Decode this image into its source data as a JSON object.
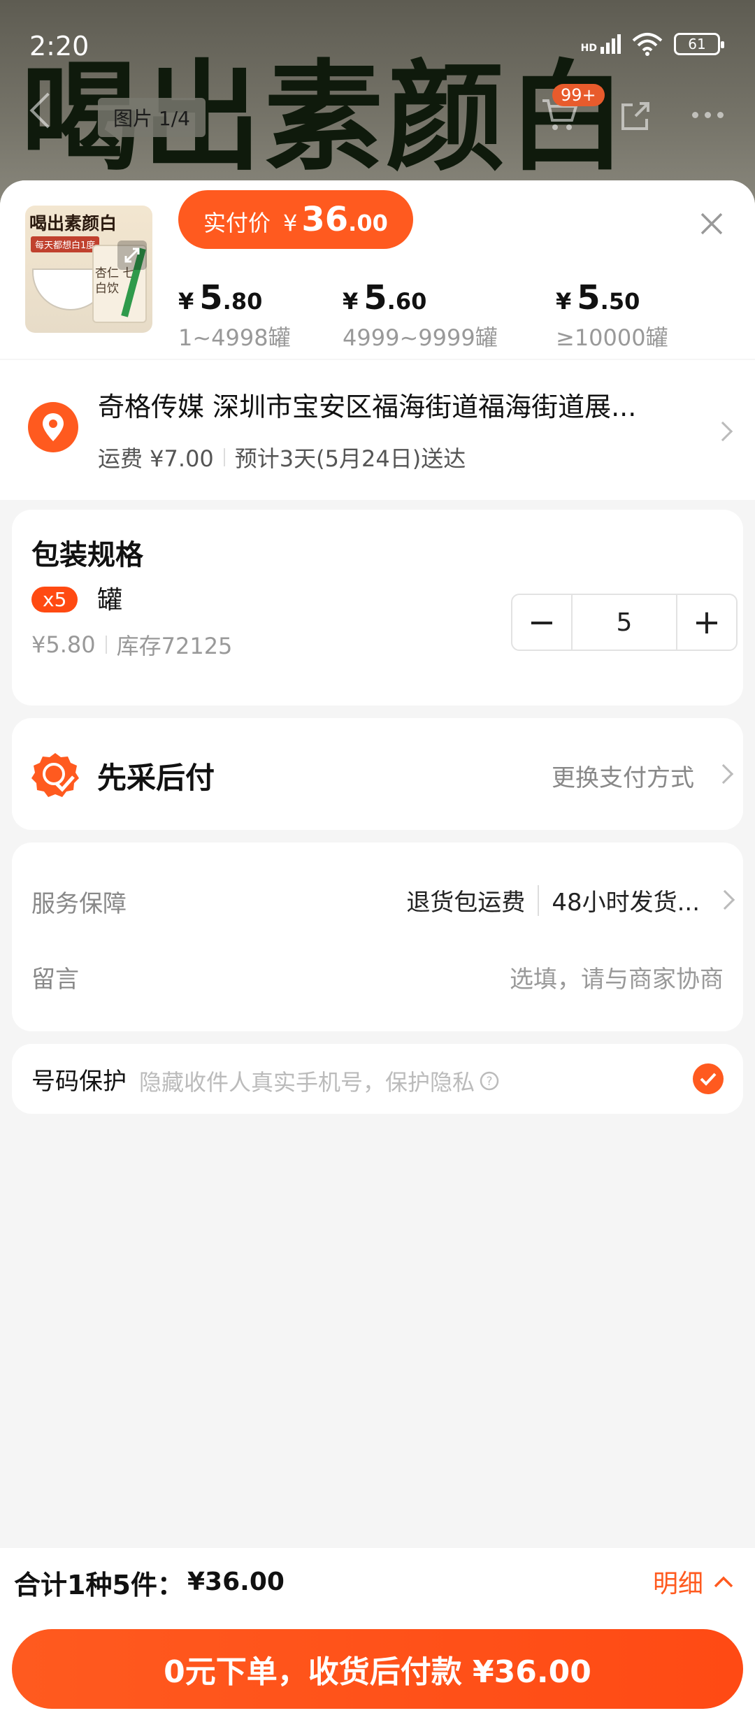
{
  "status_bar": {
    "time": "2:20",
    "network": "HD",
    "battery": "61"
  },
  "background": {
    "product_title": "喝出素颜白",
    "image_counter": "图片 1/4",
    "cart_badge": "99+"
  },
  "product": {
    "thumb_title": "喝出素颜白",
    "thumb_tag": "每天都想白1度",
    "thumb_can_text": "杏仁 七白饮",
    "actual_price_label": "实付价",
    "actual_price_currency": "¥",
    "actual_price_int": "36",
    "actual_price_dec": ".00"
  },
  "price_tiers": [
    {
      "currency": "¥",
      "int": "5",
      "dec": ".80",
      "range": "1~4998罐"
    },
    {
      "currency": "¥",
      "int": "5",
      "dec": ".60",
      "range": "4999~9999罐"
    },
    {
      "currency": "¥",
      "int": "5",
      "dec": ".50",
      "range": "≥10000罐"
    }
  ],
  "address": {
    "title": "奇格传媒  深圳市宝安区福海街道福海街道展...",
    "shipping": "运费 ¥7.00",
    "eta": "预计3天(5月24日)送达"
  },
  "spec": {
    "title": "包装规格",
    "badge": "x5",
    "unit": "罐",
    "price": "¥5.80",
    "stock": "库存72125",
    "quantity": "5",
    "minus": "−",
    "plus": "+"
  },
  "payment": {
    "title": "先采后付",
    "change": "更换支付方式"
  },
  "service": {
    "label": "服务保障",
    "item1": "退货包运费",
    "item2": "48小时发货...",
    "message_label": "留言",
    "message_placeholder": "选填，请与商家协商"
  },
  "privacy": {
    "label": "号码保护",
    "desc": "隐藏收件人真实手机号，保护隐私"
  },
  "footer": {
    "total_label": "合计1种5件：",
    "total_amount": "¥36.00",
    "detail": "明细",
    "submit": "0元下单，收货后付款 ¥36.00"
  },
  "colors": {
    "accent": "#ff5a1f",
    "background": "#f5f5f5"
  }
}
